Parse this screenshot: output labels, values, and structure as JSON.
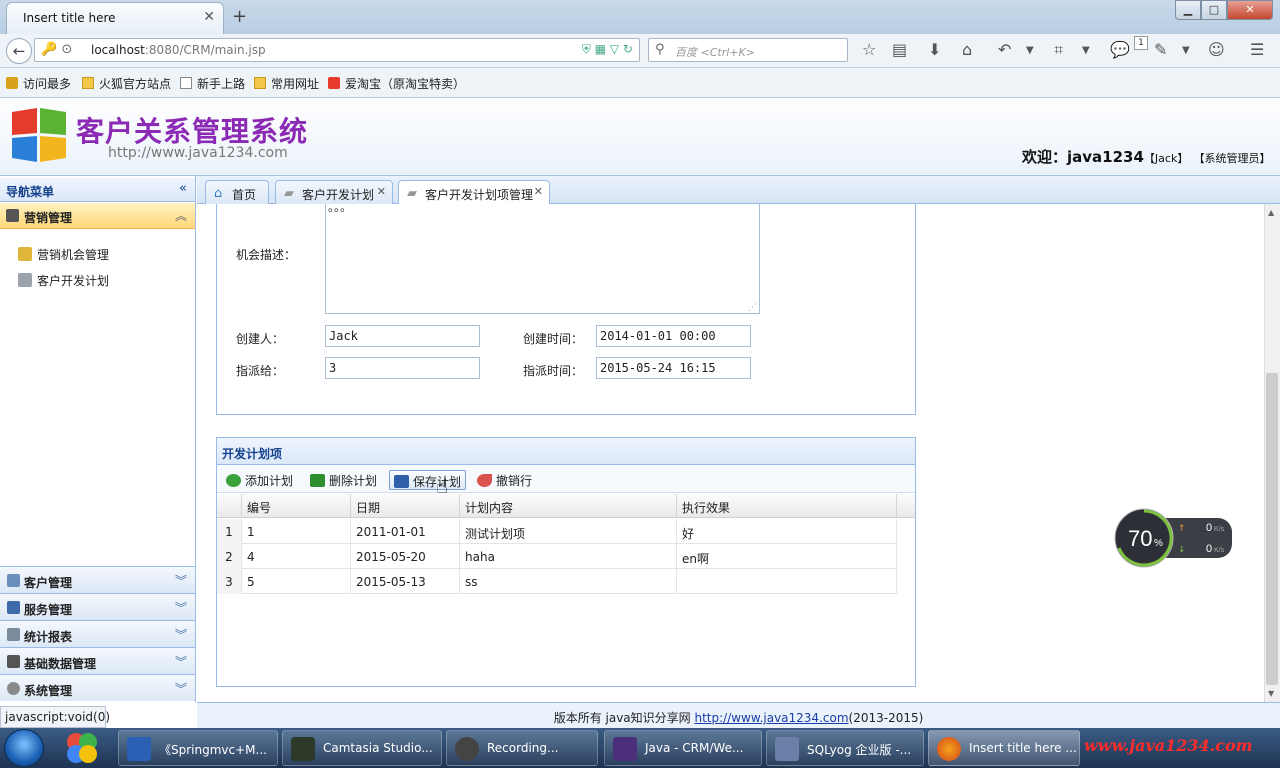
{
  "browser": {
    "tab_title": "Insert title here",
    "url_host": "localhost",
    "url_rest": ":8080/CRM/main.jsp",
    "search_placeholder": "百度 <Ctrl+K>",
    "bookmarks": [
      "访问最多",
      "火狐官方站点",
      "新手上路",
      "常用网址",
      "爱淘宝（原淘宝特卖）"
    ],
    "notification_count": "1"
  },
  "app": {
    "title": "客户关系管理系统",
    "site": "http://www.java1234.com",
    "welcome_prefix": "欢迎：java1234",
    "welcome_user": "【Jack】",
    "welcome_role": "【系统管理员】"
  },
  "nav": {
    "header": "导航菜单",
    "collapse_icon": "«",
    "marketing_section": "营销管理",
    "marketing_items": [
      "营销机会管理",
      "客户开发计划"
    ],
    "sections": [
      "客户管理",
      "服务管理",
      "统计报表",
      "基础数据管理",
      "系统管理"
    ]
  },
  "tabs": [
    {
      "label": "首页",
      "closable": false
    },
    {
      "label": "客户开发计划",
      "closable": true
    },
    {
      "label": "客户开发计划项管理",
      "closable": true
    }
  ],
  "form": {
    "desc_dots": "。。。",
    "desc_label": "机会描述：",
    "creator_label": "创建人：",
    "creator_value": "Jack",
    "create_time_label": "创建时间：",
    "create_time_value": "2014-01-01 00:00",
    "assignee_label": "指派给：",
    "assignee_value": "3",
    "assign_time_label": "指派时间：",
    "assign_time_value": "2015-05-24 16:15"
  },
  "plan": {
    "title": "开发计划项",
    "toolbar": {
      "add": "添加计划",
      "delete": "删除计划",
      "save": "保存计划",
      "undo": "撤销行"
    },
    "columns": [
      "编号",
      "日期",
      "计划内容",
      "执行效果"
    ],
    "rows": [
      {
        "rn": "1",
        "id": "1",
        "date": "2011-01-01",
        "content": "测试计划项",
        "effect": "好"
      },
      {
        "rn": "2",
        "id": "4",
        "date": "2015-05-20",
        "content": "haha",
        "effect": "en啊"
      },
      {
        "rn": "3",
        "id": "5",
        "date": "2015-05-13",
        "content": "ss",
        "effect": ""
      }
    ]
  },
  "speed_widget": {
    "percent": "70",
    "unit": "%",
    "up": "0",
    "down": "0",
    "rate_unit": "K/s"
  },
  "footer": {
    "prefix": "版本所有 java知识分享网 ",
    "link": "http://www.java1234.com",
    "suffix": "(2013-2015)"
  },
  "statusbar": "javascript:void(0)",
  "taskbar": {
    "items": [
      "《Springmvc+M...",
      "Camtasia Studio...",
      "Recording...",
      "Java - CRM/We...",
      "SQLyog 企业版 -...",
      "Insert title here ..."
    ],
    "watermark": "www.java1234.com"
  },
  "colors": {
    "accent": "#99bbe8",
    "title": "#8b2ab5",
    "highlight": "#ffd77a"
  }
}
